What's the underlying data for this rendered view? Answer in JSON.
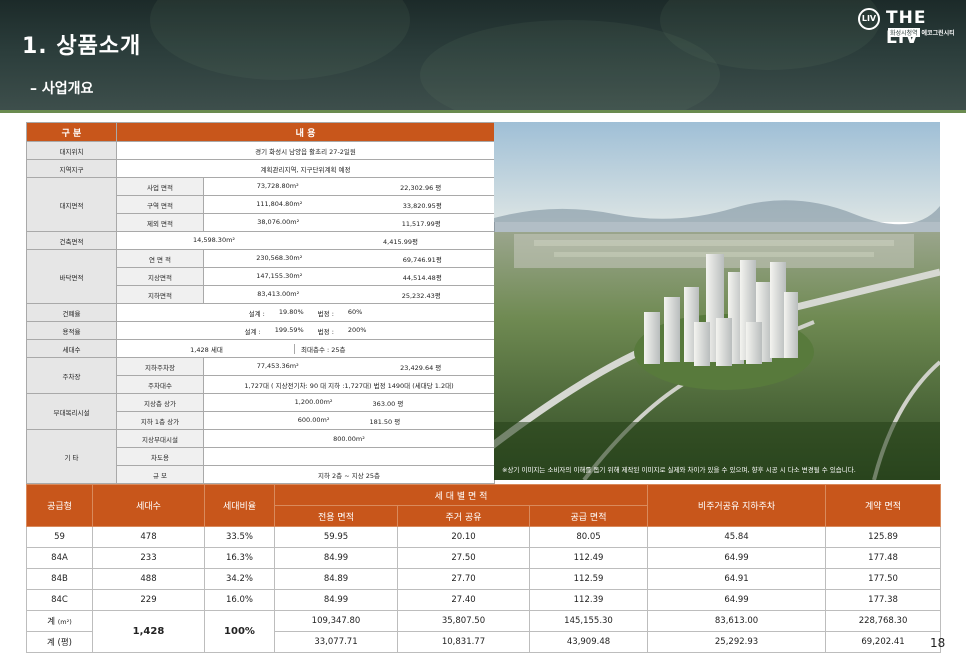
{
  "header": {
    "title": "1. 상품소개",
    "subtitle": "– 사업개요",
    "logo": {
      "mark": "LIV",
      "word": "THE LIV",
      "tag_left": "화성시청역",
      "tag_right": "에코그린시티"
    }
  },
  "spec_table": {
    "head": [
      "구 분",
      "내        용"
    ],
    "location": {
      "label": "대지위치",
      "value": "경기 화성시 남양읍 활초리 27-2일원"
    },
    "zone": {
      "label": "지역지구",
      "value": "계획관리지역, 지구단위계획 예정"
    },
    "site_area": {
      "label": "대지면적",
      "rows": [
        {
          "label": "사업 면적",
          "m2": "73,728.80m²",
          "py": "22,302.96 평"
        },
        {
          "label": "구역 면적",
          "m2": "111,804.80m²",
          "py": "33,820.95평"
        },
        {
          "label": "제외 면적",
          "m2": "38,076.00m²",
          "py": "11,517.99평"
        }
      ]
    },
    "building_area": {
      "label": "건축면적",
      "m2": "14,598.30m²",
      "py": "4,415.99평"
    },
    "floor_area": {
      "label": "바닥면적",
      "rows": [
        {
          "label": "연 면 적",
          "m2": "230,568.30m²",
          "py": "69,746.91평"
        },
        {
          "label": "지상면적",
          "m2": "147,155.30m²",
          "py": "44,514.48평"
        },
        {
          "label": "지하면적",
          "m2": "83,413.00m²",
          "py": "25,232.43평"
        }
      ]
    },
    "coverage": {
      "label": "건폐율",
      "design_label": "설계 :",
      "design": "19.80%",
      "legal_label": "법정 :",
      "legal": "60%"
    },
    "far": {
      "label": "용적율",
      "design_label": "설계 :",
      "design": "199.59%",
      "legal_label": "법정 :",
      "legal": "200%"
    },
    "households": {
      "label": "세대수",
      "value": "1,428 세대",
      "floors": "최대층수 : 25층"
    },
    "parking": {
      "label": "주차장",
      "area_label": "지하주차장",
      "area_m2": "77,453.36m²",
      "area_py": "23,429.64 평",
      "count_label": "주차대수",
      "count": "1,727대 ( 지상전기차: 90 대 지하 :1,727대)  법정  1490대 (세대당 1.2대)"
    },
    "facilities": {
      "label": "부대복리시설",
      "rows": [
        {
          "label": "지상층 상가",
          "m2": "1,200.00m²",
          "py": "363.00 평"
        },
        {
          "label": "지하 1층 상가",
          "m2": "600.00m²",
          "py": "181.50 평"
        }
      ]
    },
    "etc": {
      "label": "기    타",
      "rows": [
        {
          "label": "지상부대시설",
          "value": "800.00m²"
        },
        {
          "label": "차도용",
          "value": ""
        },
        {
          "label": "규  모",
          "value": "지하 2층 ~ 지상 25층"
        }
      ]
    }
  },
  "photo": {
    "caption": "※상기 이미지는 소비자의 이해를 돕기 위해 제작된 이미지로 실제와 차이가 있을 수 있으며, 향후 시공 시 다소 변경될 수 있습니다."
  },
  "supply_table": {
    "head": {
      "type": "공급형",
      "households": "세대수",
      "ratio": "세대비율",
      "area_group": "세 대 별 면 적",
      "exclusive": "전용 면적",
      "common": "주거 공유",
      "supply": "공급 면적",
      "parking": "비주거공유    지하주차",
      "contract": "계약 면적"
    },
    "rows": [
      {
        "type": "59",
        "households": "478",
        "ratio": "33.5%",
        "exclusive": "59.95",
        "common": "20.10",
        "supply": "80.05",
        "parking": "45.84",
        "contract": "125.89"
      },
      {
        "type": "84A",
        "households": "233",
        "ratio": "16.3%",
        "exclusive": "84.99",
        "common": "27.50",
        "supply": "112.49",
        "parking": "64.99",
        "contract": "177.48"
      },
      {
        "type": "84B",
        "households": "488",
        "ratio": "34.2%",
        "exclusive": "84.89",
        "common": "27.70",
        "supply": "112.59",
        "parking": "64.91",
        "contract": "177.50"
      },
      {
        "type": "84C",
        "households": "229",
        "ratio": "16.0%",
        "exclusive": "84.99",
        "common": "27.40",
        "supply": "112.39",
        "parking": "64.99",
        "contract": "177.38"
      }
    ],
    "total_m2": {
      "label": "계",
      "unit": "(m²)",
      "exclusive": "109,347.80",
      "common": "35,807.50",
      "supply": "145,155.30",
      "parking": "83,613.00",
      "contract": "228,768.30"
    },
    "total_py": {
      "label": "계 (평)",
      "exclusive": "33,077.71",
      "common": "10,831.77",
      "supply": "43,909.48",
      "parking": "25,292.93",
      "contract": "69,202.41"
    },
    "total_households": "1,428",
    "total_ratio": "100%"
  },
  "page_number": "18"
}
